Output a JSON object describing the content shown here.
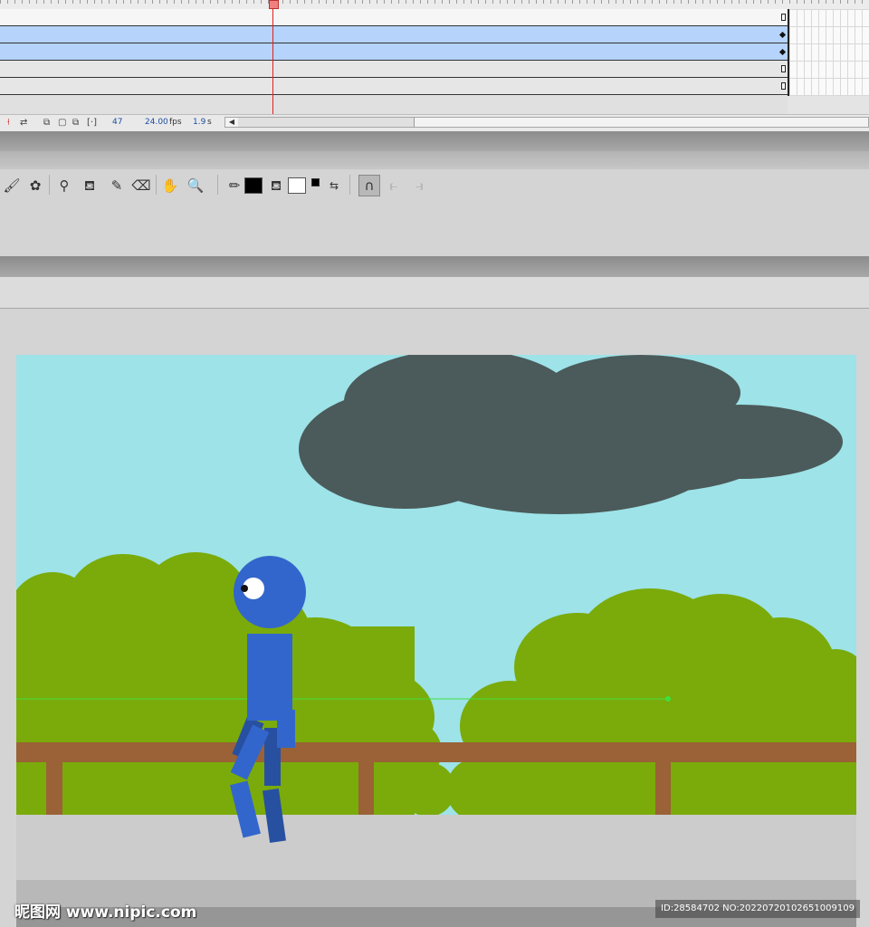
{
  "timeline": {
    "current_frame": "47",
    "fps": "24.00",
    "fps_unit": "fps",
    "elapsed": "1.9",
    "elapsed_unit": "s",
    "layers": [
      {
        "style": "white",
        "marker": "hollow"
      },
      {
        "style": "blue",
        "marker": "dot"
      },
      {
        "style": "blue",
        "marker": "dot"
      },
      {
        "style": "gray",
        "marker": "hollow"
      },
      {
        "style": "gray",
        "marker": "hollow"
      }
    ]
  },
  "toolbar": {
    "tools": [
      "brush-icon",
      "deco-icon",
      "bone-icon",
      "paint-bucket-icon",
      "eyedropper-icon",
      "eraser-icon",
      "hand-icon",
      "zoom-icon",
      "stroke-color-icon",
      "fill-color-icon",
      "swap-colors-icon",
      "snap-magnet-icon",
      "smooth-icon",
      "straighten-icon"
    ],
    "stroke_color": "#000000",
    "fill_color": "#ffffff"
  },
  "stage": {
    "sky_color": "#9de3e8",
    "cloud_color": "#4b5a5a",
    "bush_color": "#7aab0a",
    "fence_color": "#9a6236",
    "ground_color": "#cccccc",
    "character_color": "#3366cc"
  },
  "watermark": {
    "left": "昵图网 www.nipic.com",
    "right": "ID:28584702 NO:20220720102651009109"
  }
}
